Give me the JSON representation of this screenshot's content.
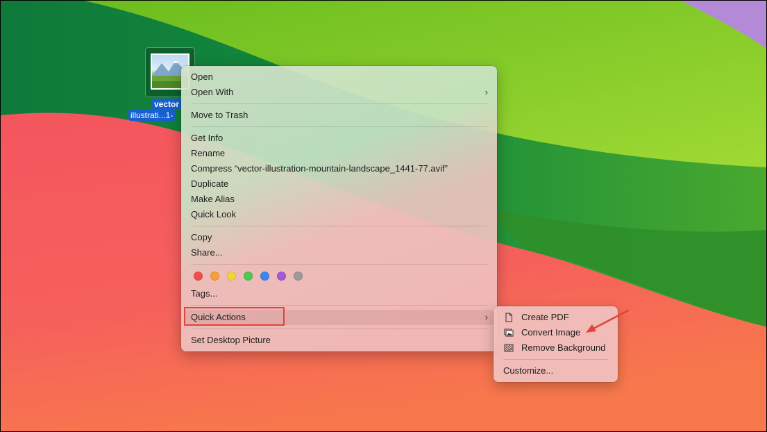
{
  "desktop_file": {
    "name_line1": "vector",
    "name_line2": "illustrati...1-"
  },
  "context_menu": {
    "items": [
      {
        "label": "Open",
        "submenu": false
      },
      {
        "label": "Open With",
        "submenu": true
      },
      {
        "label": "Move to Trash",
        "submenu": false
      },
      {
        "label": "Get Info",
        "submenu": false
      },
      {
        "label": "Rename",
        "submenu": false
      },
      {
        "label": "Compress “vector-illustration-mountain-landscape_1441-77.avif”",
        "submenu": false
      },
      {
        "label": "Duplicate",
        "submenu": false
      },
      {
        "label": "Make Alias",
        "submenu": false
      },
      {
        "label": "Quick Look",
        "submenu": false
      },
      {
        "label": "Copy",
        "submenu": false
      },
      {
        "label": "Share...",
        "submenu": false
      },
      {
        "label": "Tags...",
        "submenu": false
      },
      {
        "label": "Quick Actions",
        "submenu": true,
        "highlighted": true
      },
      {
        "label": "Set Desktop Picture",
        "submenu": false
      }
    ],
    "tag_colors": [
      {
        "name": "red",
        "color": "#f24e4e"
      },
      {
        "name": "orange",
        "color": "#f5a03a"
      },
      {
        "name": "yellow",
        "color": "#f5d33a"
      },
      {
        "name": "green",
        "color": "#4fc750"
      },
      {
        "name": "blue",
        "color": "#3b86f0"
      },
      {
        "name": "purple",
        "color": "#a75ad8"
      },
      {
        "name": "gray",
        "color": "#9b9b9b"
      }
    ]
  },
  "quick_actions_submenu": {
    "items": [
      {
        "label": "Create PDF",
        "icon": "document-icon"
      },
      {
        "label": "Convert Image",
        "icon": "photo-convert-icon"
      },
      {
        "label": "Remove Background",
        "icon": "remove-background-icon"
      }
    ],
    "customize_label": "Customize..."
  },
  "colors": {
    "highlight_box": "#e2433a",
    "annotation_arrow": "#e2433a",
    "selection_label": "#1860d0"
  }
}
